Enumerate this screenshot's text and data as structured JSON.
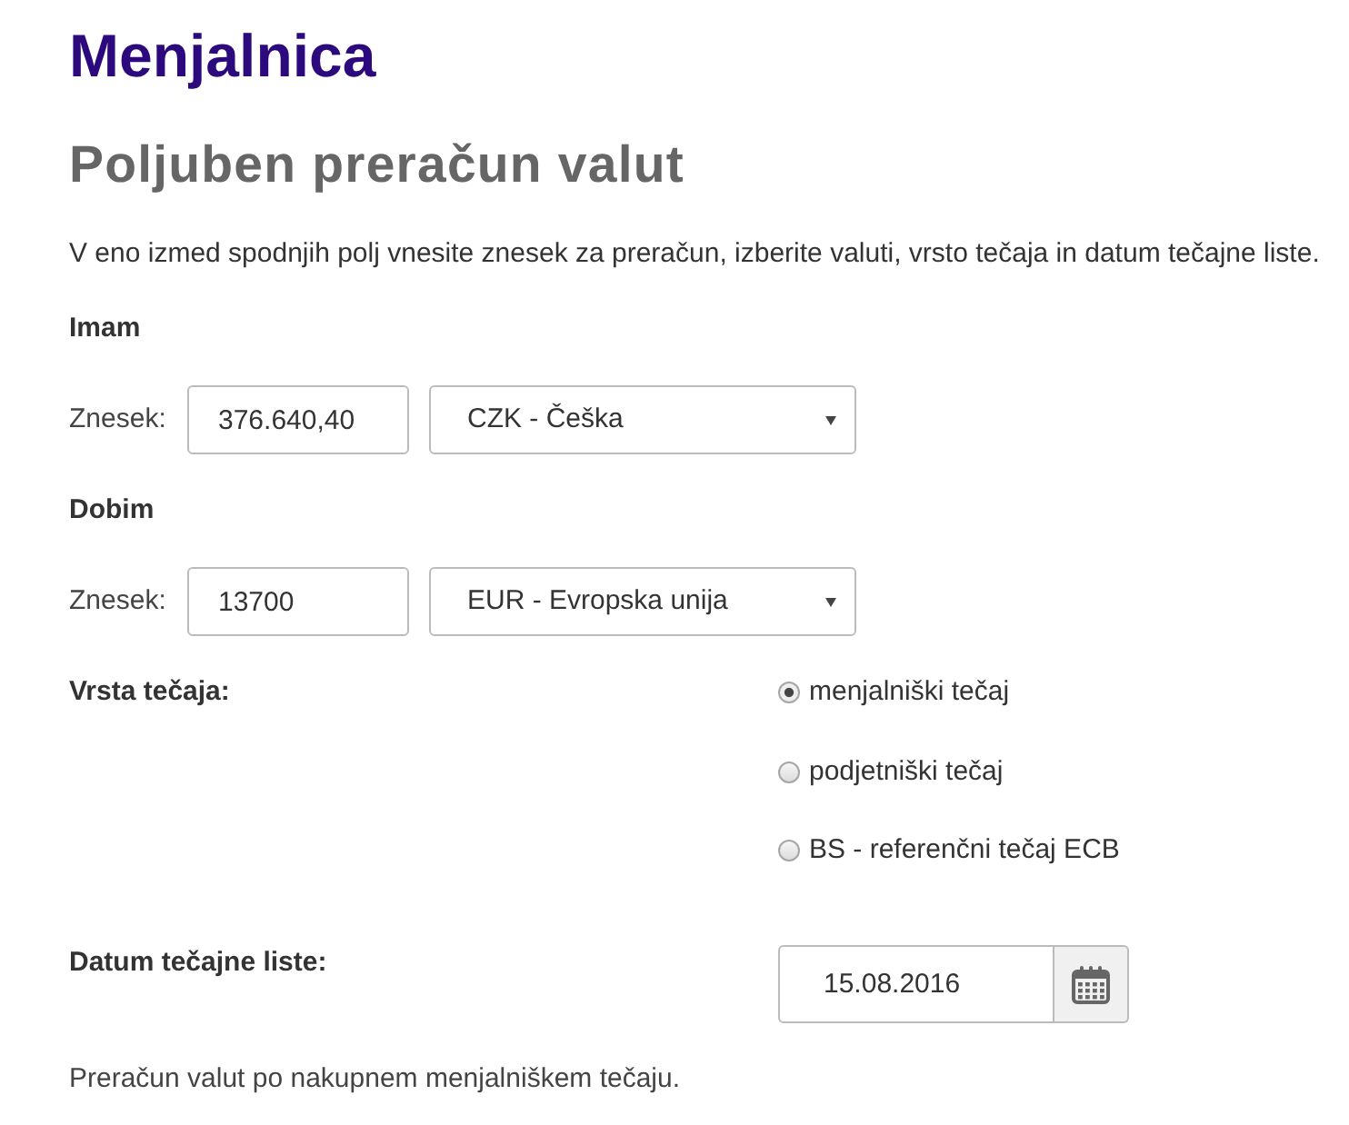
{
  "title": "Menjalnica",
  "subtitle": "Poljuben preračun valut",
  "intro": "V eno izmed spodnjih polj vnesite znesek za preračun, izberite valuti, vrsto tečaja in datum tečajne liste.",
  "sections": [
    {
      "heading": "Imam",
      "amount_label": "Znesek:",
      "amount": "376.640,40",
      "currency": "CZK - Češka"
    },
    {
      "heading": "Dobim",
      "amount_label": "Znesek:",
      "amount": "13700",
      "currency": "EUR - Evropska unija"
    }
  ],
  "rate_type": {
    "label": "Vrsta tečaja:",
    "options": [
      {
        "label": "menjalniški tečaj",
        "selected": true
      },
      {
        "label": "podjetniški tečaj",
        "selected": false
      },
      {
        "label": "BS - referenčni tečaj ECB",
        "selected": false
      }
    ]
  },
  "date": {
    "label": "Datum tečajne liste:",
    "value": "15.08.2016"
  },
  "note": "Preračun valut po nakupnem menjalniškem tečaju."
}
